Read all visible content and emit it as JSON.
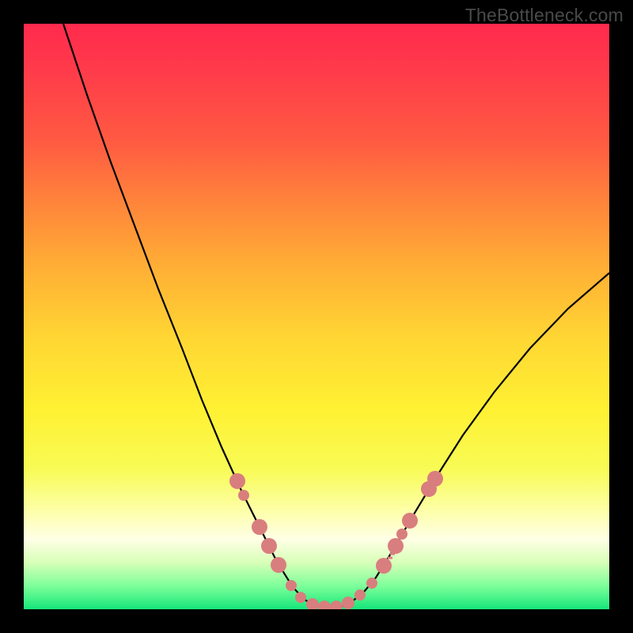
{
  "watermark": "TheBottleneck.com",
  "chart_data": {
    "type": "line",
    "title": "",
    "xlabel": "",
    "ylabel": "",
    "xlim": [
      0,
      740
    ],
    "ylim": [
      0,
      740
    ],
    "curve": {
      "name": "bottleneck-curve",
      "points": [
        {
          "x": 50,
          "y": 0
        },
        {
          "x": 80,
          "y": 90
        },
        {
          "x": 110,
          "y": 175
        },
        {
          "x": 140,
          "y": 255
        },
        {
          "x": 170,
          "y": 335
        },
        {
          "x": 200,
          "y": 410
        },
        {
          "x": 225,
          "y": 475
        },
        {
          "x": 250,
          "y": 535
        },
        {
          "x": 275,
          "y": 590
        },
        {
          "x": 300,
          "y": 640
        },
        {
          "x": 320,
          "y": 680
        },
        {
          "x": 340,
          "y": 712
        },
        {
          "x": 355,
          "y": 728
        },
        {
          "x": 370,
          "y": 736
        },
        {
          "x": 385,
          "y": 738
        },
        {
          "x": 400,
          "y": 737
        },
        {
          "x": 415,
          "y": 730
        },
        {
          "x": 430,
          "y": 718
        },
        {
          "x": 445,
          "y": 700
        },
        {
          "x": 465,
          "y": 668
        },
        {
          "x": 490,
          "y": 625
        },
        {
          "x": 520,
          "y": 575
        },
        {
          "x": 555,
          "y": 520
        },
        {
          "x": 595,
          "y": 465
        },
        {
          "x": 640,
          "y": 410
        },
        {
          "x": 688,
          "y": 360
        },
        {
          "x": 740,
          "y": 315
        }
      ]
    },
    "markers": {
      "name": "highlight-dots",
      "color": "#d97e7e",
      "radius_small": 7,
      "radius_large": 10,
      "points": [
        {
          "x": 270,
          "y": 578,
          "r": 10
        },
        {
          "x": 278,
          "y": 596,
          "r": 7
        },
        {
          "x": 298,
          "y": 636,
          "r": 10
        },
        {
          "x": 310,
          "y": 660,
          "r": 10
        },
        {
          "x": 322,
          "y": 684,
          "r": 10
        },
        {
          "x": 338,
          "y": 710,
          "r": 7
        },
        {
          "x": 350,
          "y": 725,
          "r": 7
        },
        {
          "x": 365,
          "y": 734,
          "r": 8
        },
        {
          "x": 380,
          "y": 737,
          "r": 8
        },
        {
          "x": 395,
          "y": 737,
          "r": 8
        },
        {
          "x": 410,
          "y": 732,
          "r": 8
        },
        {
          "x": 425,
          "y": 722,
          "r": 7
        },
        {
          "x": 440,
          "y": 707,
          "r": 7
        },
        {
          "x": 455,
          "y": 685,
          "r": 10
        },
        {
          "x": 470,
          "y": 660,
          "r": 10
        },
        {
          "x": 478,
          "y": 645,
          "r": 7
        },
        {
          "x": 488,
          "y": 628,
          "r": 10
        },
        {
          "x": 512,
          "y": 588,
          "r": 10
        },
        {
          "x": 520,
          "y": 575,
          "r": 10
        }
      ]
    },
    "ticks": {
      "color": "#d97e7e",
      "points": [
        {
          "x": 460,
          "y": 675
        },
        {
          "x": 463,
          "y": 670
        },
        {
          "x": 466,
          "y": 665
        },
        {
          "x": 469,
          "y": 660
        }
      ]
    },
    "gradient_stops": [
      {
        "pos": 0,
        "color": "#ff2a4d"
      },
      {
        "pos": 50,
        "color": "#ffd733"
      },
      {
        "pos": 88,
        "color": "#ffffe6"
      },
      {
        "pos": 100,
        "color": "#16e67a"
      }
    ]
  }
}
